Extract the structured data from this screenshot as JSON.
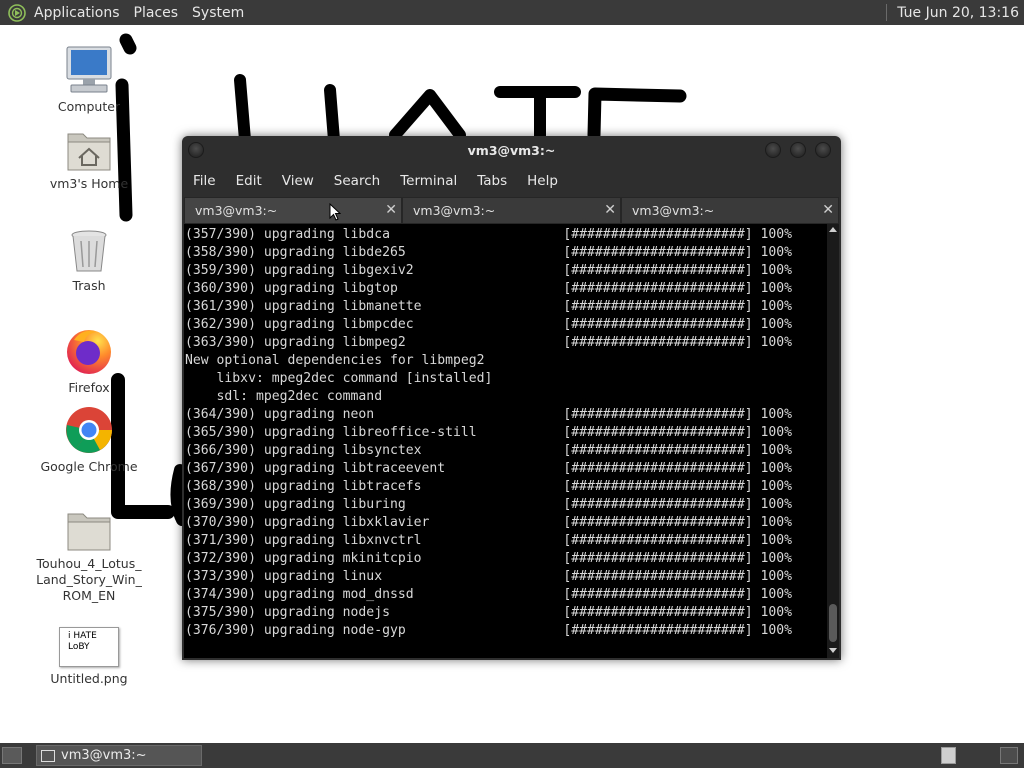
{
  "top_panel": {
    "menus": [
      "Applications",
      "Places",
      "System"
    ],
    "clock": "Tue Jun 20, 13:16"
  },
  "desktop": {
    "icons": [
      {
        "label": "Computer",
        "icon": "computer-icon"
      },
      {
        "label": "vm3's Home",
        "icon": "home-folder-icon"
      },
      {
        "label": "Trash",
        "icon": "trash-icon"
      },
      {
        "label": "Firefox",
        "icon": "firefox-icon"
      },
      {
        "label": "Google Chrome",
        "icon": "chrome-icon"
      },
      {
        "label": "Touhou_4_Lotus_Land_Story_Win_ROM_EN",
        "label_lines": [
          "Touhou_4_Lotus_",
          "Land_Story_Win_",
          "ROM_EN"
        ],
        "icon": "folder-icon"
      },
      {
        "label": "Untitled.png",
        "icon": "image-thumbnail-icon",
        "thumbnail_text": [
          "i HATE",
          "LoBY"
        ]
      }
    ]
  },
  "terminal": {
    "title": "vm3@vm3:~",
    "menus": [
      "File",
      "Edit",
      "View",
      "Search",
      "Terminal",
      "Tabs",
      "Help"
    ],
    "tabs": [
      {
        "label": "vm3@vm3:~",
        "active": true
      },
      {
        "label": "vm3@vm3:~",
        "active": false
      },
      {
        "label": "vm3@vm3:~",
        "active": false
      }
    ],
    "close_glyph": "✕",
    "lines": [
      "(357/390) upgrading libdca                      [######################] 100%",
      "(358/390) upgrading libde265                    [######################] 100%",
      "(359/390) upgrading libgexiv2                   [######################] 100%",
      "(360/390) upgrading libgtop                     [######################] 100%",
      "(361/390) upgrading libmanette                  [######################] 100%",
      "(362/390) upgrading libmpcdec                   [######################] 100%",
      "(363/390) upgrading libmpeg2                    [######################] 100%",
      "New optional dependencies for libmpeg2",
      "    libxv: mpeg2dec command [installed]",
      "    sdl: mpeg2dec command",
      "(364/390) upgrading neon                        [######################] 100%",
      "(365/390) upgrading libreoffice-still           [######################] 100%",
      "(366/390) upgrading libsynctex                  [######################] 100%",
      "(367/390) upgrading libtraceevent               [######################] 100%",
      "(368/390) upgrading libtracefs                  [######################] 100%",
      "(369/390) upgrading liburing                    [######################] 100%",
      "(370/390) upgrading libxklavier                 [######################] 100%",
      "(371/390) upgrading libxnvctrl                  [######################] 100%",
      "(372/390) upgrading mkinitcpio                  [######################] 100%",
      "(373/390) upgrading linux                       [######################] 100%",
      "(374/390) upgrading mod_dnssd                   [######################] 100%",
      "(375/390) upgrading nodejs                      [######################] 100%",
      "(376/390) upgrading node-gyp                    [######################] 100%"
    ]
  },
  "bottom_panel": {
    "task_label": "vm3@vm3:~"
  },
  "colors": {
    "panel_bg": "#3a3a3a",
    "terminal_bg": "#000000",
    "terminal_text": "#d8d8d8",
    "desktop_bg": "#ffffff",
    "scribble": "#000000"
  }
}
